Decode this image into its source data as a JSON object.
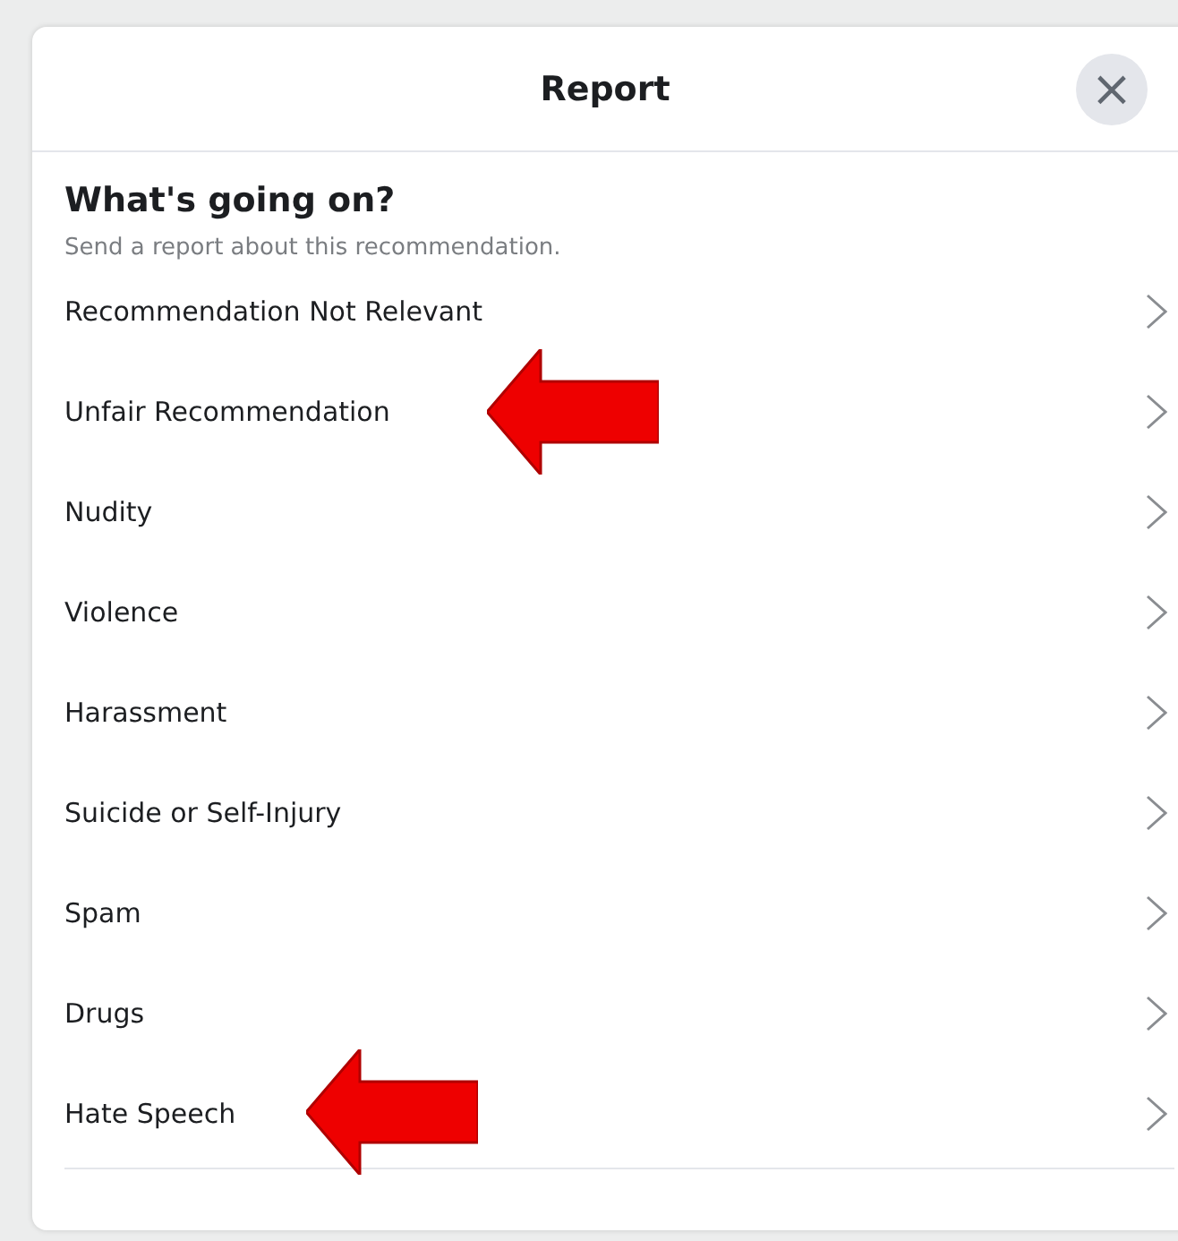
{
  "dialog": {
    "title": "Report",
    "close": "×"
  },
  "heading": "What's going on?",
  "subtitle": "Send a report about this recommendation.",
  "options": [
    {
      "label": "Recommendation Not Relevant",
      "marked": false
    },
    {
      "label": "Unfair Recommendation",
      "marked": true
    },
    {
      "label": "Nudity",
      "marked": false
    },
    {
      "label": "Violence",
      "marked": false
    },
    {
      "label": "Harassment",
      "marked": false
    },
    {
      "label": "Suicide or Self-Injury",
      "marked": false
    },
    {
      "label": "Spam",
      "marked": false
    },
    {
      "label": "Drugs",
      "marked": false
    },
    {
      "label": "Hate Speech",
      "marked": true
    }
  ]
}
